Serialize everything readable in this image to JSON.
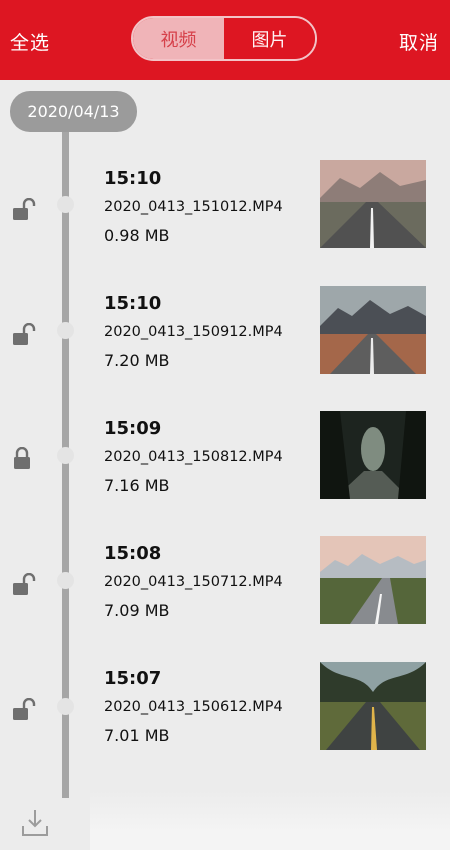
{
  "header": {
    "select_all": "全选",
    "cancel": "取消",
    "tabs": [
      {
        "label": "视频",
        "active": true
      },
      {
        "label": "图片",
        "active": false
      }
    ]
  },
  "timeline": {
    "date": "2020/04/13",
    "items": [
      {
        "time": "15:10",
        "filename": "2020_0413_151012.MP4",
        "size": "0.98 MB",
        "locked": false,
        "thumb_icon": "road-straight-plain"
      },
      {
        "time": "15:10",
        "filename": "2020_0413_150912.MP4",
        "size": "7.20 MB",
        "locked": false,
        "thumb_icon": "road-mountains"
      },
      {
        "time": "15:09",
        "filename": "2020_0413_150812.MP4",
        "size": "7.16 MB",
        "locked": true,
        "thumb_icon": "forest-tunnel"
      },
      {
        "time": "15:08",
        "filename": "2020_0413_150712.MP4",
        "size": "7.09 MB",
        "locked": false,
        "thumb_icon": "road-curve-snow-mountains"
      },
      {
        "time": "15:07",
        "filename": "2020_0413_150612.MP4",
        "size": "7.01 MB",
        "locked": false,
        "thumb_icon": "tree-lined-road"
      }
    ]
  },
  "colors": {
    "accent": "#dd1622",
    "timeline": "#a6a6a6",
    "background": "#ececec"
  }
}
